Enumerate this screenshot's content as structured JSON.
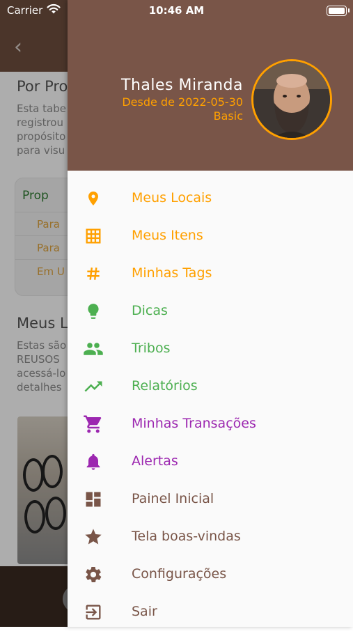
{
  "status_bar": {
    "carrier": "Carrier",
    "time": "10:46 AM"
  },
  "background": {
    "section1_title": "Por Pro",
    "section1_text": "Esta tabe registrou propósito para visu",
    "card_header": "Prop",
    "card_rows": [
      "Para",
      "Para",
      "Em U"
    ],
    "section2_title": "Meus L",
    "section2_text": "Estas são REUSOS acessá-lo detalhes"
  },
  "drawer": {
    "user": {
      "name": "Thales Miranda",
      "since": "Desde de 2022-05-30",
      "plan": "Basic"
    },
    "menu": [
      {
        "label": "Meus Locais",
        "icon": "location-pin-icon",
        "color": "#ffa000"
      },
      {
        "label": "Meus Itens",
        "icon": "grid-icon",
        "color": "#ffa000"
      },
      {
        "label": "Minhas Tags",
        "icon": "hashtag-icon",
        "color": "#ffa000"
      },
      {
        "label": "Dicas",
        "icon": "lightbulb-icon",
        "color": "#4caf50"
      },
      {
        "label": "Tribos",
        "icon": "people-icon",
        "color": "#4caf50"
      },
      {
        "label": "Relatórios",
        "icon": "trending-up-icon",
        "color": "#4caf50"
      },
      {
        "label": "Minhas Transações",
        "icon": "shopping-cart-icon",
        "color": "#9c27b0"
      },
      {
        "label": "Alertas",
        "icon": "bell-icon",
        "color": "#9c27b0"
      },
      {
        "label": "Painel Inicial",
        "icon": "dashboard-icon",
        "color": "#795548"
      },
      {
        "label": "Tela boas-vindas",
        "icon": "star-icon",
        "color": "#795548"
      },
      {
        "label": "Configurações",
        "icon": "gear-icon",
        "color": "#795548"
      },
      {
        "label": "Sair",
        "icon": "logout-icon",
        "color": "#795548"
      }
    ]
  }
}
